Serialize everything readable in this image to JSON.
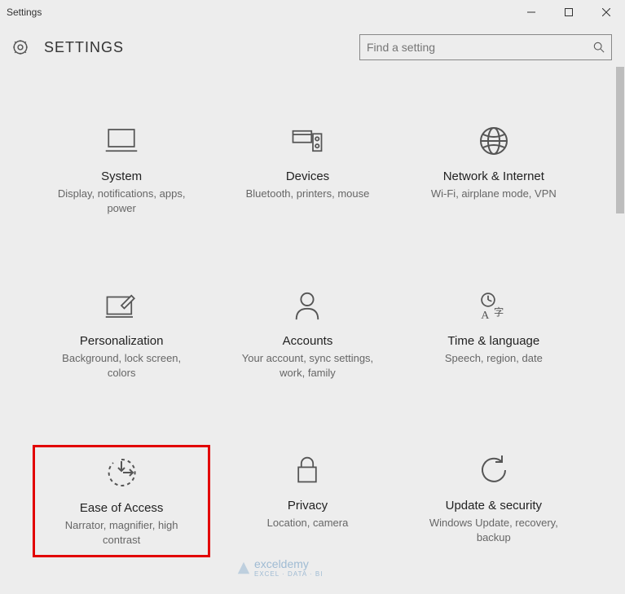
{
  "window": {
    "title": "Settings"
  },
  "header": {
    "title": "SETTINGS"
  },
  "search": {
    "placeholder": "Find a setting"
  },
  "tiles": [
    {
      "title": "System",
      "desc": "Display, notifications, apps, power"
    },
    {
      "title": "Devices",
      "desc": "Bluetooth, printers, mouse"
    },
    {
      "title": "Network & Internet",
      "desc": "Wi-Fi, airplane mode, VPN"
    },
    {
      "title": "Personalization",
      "desc": "Background, lock screen, colors"
    },
    {
      "title": "Accounts",
      "desc": "Your account, sync settings, work, family"
    },
    {
      "title": "Time & language",
      "desc": "Speech, region, date"
    },
    {
      "title": "Ease of Access",
      "desc": "Narrator, magnifier, high contrast"
    },
    {
      "title": "Privacy",
      "desc": "Location, camera"
    },
    {
      "title": "Update & security",
      "desc": "Windows Update, recovery, backup"
    }
  ],
  "watermark": {
    "brand": "exceldemy",
    "sub": "EXCEL · DATA · BI"
  },
  "highlighted_index": 6
}
